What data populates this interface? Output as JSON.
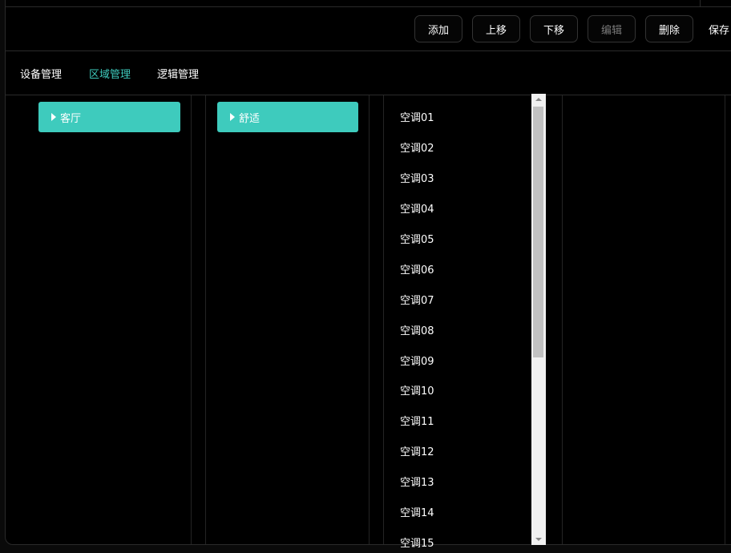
{
  "toolbar": {
    "buttons": [
      {
        "label": "添加",
        "enabled": true
      },
      {
        "label": "上移",
        "enabled": true
      },
      {
        "label": "下移",
        "enabled": true
      },
      {
        "label": "编辑",
        "enabled": false
      },
      {
        "label": "删除",
        "enabled": true
      },
      {
        "label": "保存",
        "enabled": true
      }
    ]
  },
  "tabs": [
    {
      "label": "设备管理",
      "active": false
    },
    {
      "label": "区域管理",
      "active": true
    },
    {
      "label": "逻辑管理",
      "active": false
    }
  ],
  "columns": {
    "area": {
      "selected": "客厅"
    },
    "scene": {
      "selected": "舒适"
    }
  },
  "devices": [
    "空调01",
    "空调02",
    "空调03",
    "空调04",
    "空调05",
    "空调06",
    "空调07",
    "空调08",
    "空调09",
    "空调10",
    "空调11",
    "空调12",
    "空调13",
    "空调14",
    "空调15"
  ],
  "colors": {
    "accent": "#3ecbbd",
    "background": "#000000",
    "border": "#2a2a2a"
  }
}
